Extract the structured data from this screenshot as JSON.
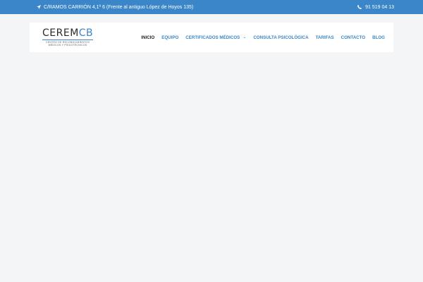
{
  "topbar": {
    "address": "C/RAMOS CARRIÓN 4,1º 6 (Frente al antiguo López de Hoyos 135)",
    "address_icon": "location-arrow-icon",
    "phone": "91 519 04 13",
    "phone_icon": "phone-icon"
  },
  "logo": {
    "main": "CEREM",
    "accent": "CB",
    "tagline_1": "CENTRO DE RECONOCIMIENTOS",
    "tagline_2": "MÉDICOS Y PSICOTÉCNICOS"
  },
  "nav": {
    "items": [
      {
        "label": "INICIO"
      },
      {
        "label": "EQUIPO"
      },
      {
        "label": "CERTIFICADOS MÉDICOS",
        "dropdown_icon": "chevron-down-icon"
      },
      {
        "label": "CONSULTA PSICOLÓGICA"
      },
      {
        "label": "TARIFAS"
      },
      {
        "label": "CONTACTO"
      },
      {
        "label": "BLOG"
      }
    ]
  },
  "colors": {
    "accent": "#3a86c8",
    "nav_active": "#222222",
    "background": "#f3f5f7"
  }
}
